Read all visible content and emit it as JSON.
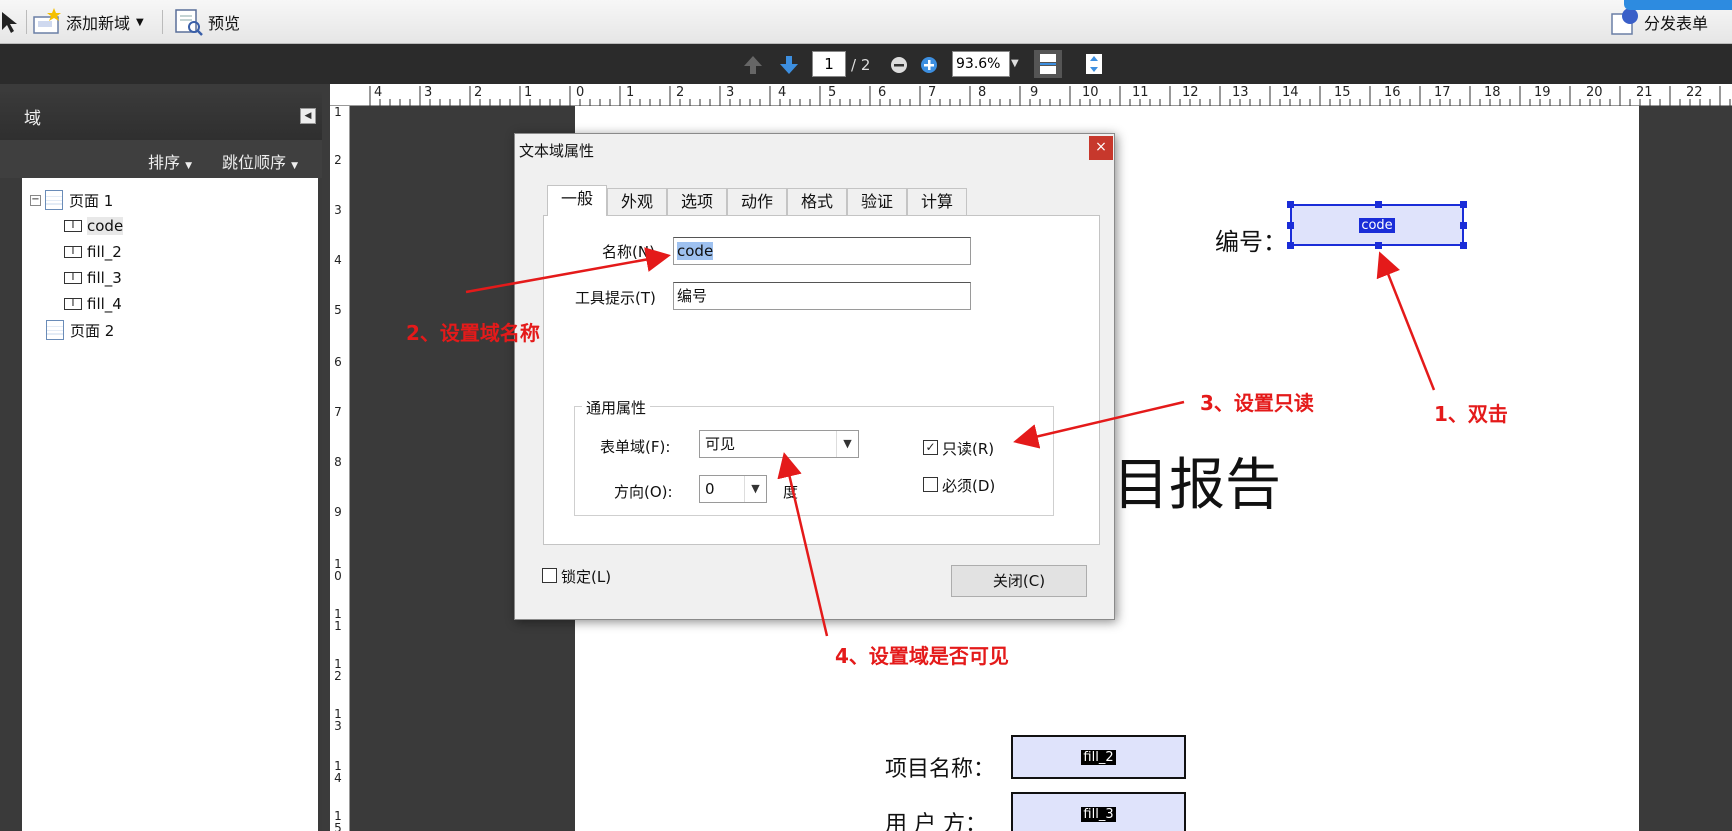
{
  "toolbar": {
    "add_field": "添加新域",
    "preview": "预览",
    "distribute_form": "分发表单"
  },
  "nav": {
    "current_page": "1",
    "total_pages": "/ 2",
    "zoom": "93.6%"
  },
  "panel": {
    "title": "域",
    "sort": "排序",
    "tab_order": "跳位顺序",
    "tree": {
      "page1": "页面 1",
      "fields": [
        "code",
        "fill_2",
        "fill_3",
        "fill_4"
      ],
      "page2": "页面 2"
    }
  },
  "rulers": {
    "horizontal": [
      "4",
      "3",
      "2",
      "1",
      "0",
      "1",
      "2",
      "3",
      "4",
      "5",
      "6",
      "7",
      "8",
      "9",
      "10",
      "11",
      "12",
      "13",
      "14",
      "15",
      "16",
      "17",
      "18",
      "19",
      "20",
      "21",
      "22"
    ],
    "vertical": [
      "1",
      "2",
      "3",
      "4",
      "5",
      "6",
      "7",
      "8",
      "9",
      "10",
      "11",
      "12",
      "13",
      "14",
      "15"
    ]
  },
  "page": {
    "code_label": "编号：",
    "code_field": "code",
    "title_fragment": "项目报告",
    "project_name_label": "项目名称：",
    "project_name_field": "fill_2",
    "user_label": "用 户 方：",
    "user_field": "fill_3"
  },
  "dialog": {
    "title": "文本域属性",
    "close_x": "×",
    "tabs": [
      "一般",
      "外观",
      "选项",
      "动作",
      "格式",
      "验证",
      "计算"
    ],
    "name_label": "名称(N)",
    "name_value": "code",
    "tooltip_label": "工具提示(T)",
    "tooltip_value": "编号",
    "group_title": "通用属性",
    "form_field_label": "表单域(F):",
    "form_field_value": "可见",
    "orientation_label": "方向(O):",
    "orientation_value": "0",
    "degree": "度",
    "readonly_label": "只读(R)",
    "readonly_checked": true,
    "required_label": "必须(D)",
    "required_checked": false,
    "lock_label": "锁定(L)",
    "lock_checked": false,
    "close_button": "关闭(C)"
  },
  "annotations": {
    "step1": "1、双击",
    "step2": "2、设置域名称",
    "step3": "3、设置只读",
    "step4": "4、设置域是否可见"
  },
  "colors": {
    "annotation_red": "#e41a1a",
    "field_fill": "#dfe3fb",
    "selection_blue": "#1a2dd8",
    "dark_bg": "#3a3a3a"
  }
}
